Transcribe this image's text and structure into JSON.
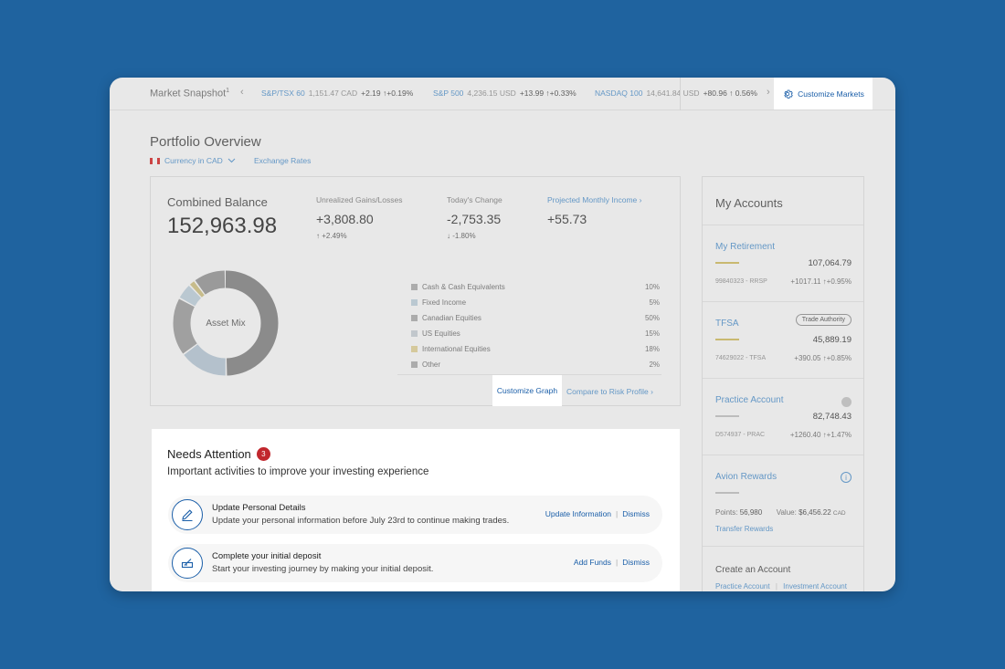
{
  "ticker": {
    "title": "Market Snapshot",
    "title_sup": "1",
    "items": [
      {
        "name": "S&P/TSX 60",
        "price": "1,151.47 CAD",
        "change": "+2.19 ↑+0.19%"
      },
      {
        "name": "S&P 500",
        "price": "4,236.15 USD",
        "change": "+13.99 ↑+0.33%"
      },
      {
        "name": "NASDAQ 100",
        "price": "14,641.84 USD",
        "change": "+80.96 ↑ 0.56%"
      }
    ],
    "customize_label": "Customize Markets"
  },
  "header": {
    "title": "Portfolio Overview",
    "currency": "Currency in CAD",
    "exchange_rates": "Exchange Rates"
  },
  "overview": {
    "combined_label": "Combined Balance",
    "combined_value": "152,963.98",
    "unrealized_label": "Unrealized Gains/Losses",
    "unrealized_value": "+3,808.80",
    "unrealized_pct": "↑ +2.49%",
    "today_label": "Today's Change",
    "today_value": "-2,753.35",
    "today_pct": "↓ -1.80%",
    "income_label": "Projected Monthly Income",
    "income_value": "+55.73",
    "donut_label": "Asset Mix",
    "customize_graph": "Customize Graph",
    "compare_risk": "Compare to Risk Profile"
  },
  "asset_mix": [
    {
      "name": "Cash & Cash Equivalents",
      "pct": "10%",
      "value": 10,
      "color": "#9e9e9e",
      "legend": "#b5b5b5"
    },
    {
      "name": "Fixed Income",
      "pct": "5%",
      "value": 5,
      "color": "#c6d7e3",
      "legend": "#c6d7e3"
    },
    {
      "name": "Canadian Equities",
      "pct": "50%",
      "value": 50,
      "color": "#8b8b8b",
      "legend": "#b5b5b5"
    },
    {
      "name": "US Equities",
      "pct": "15%",
      "value": 15,
      "color": "#bfcfdc",
      "legend": "#cfd6dc"
    },
    {
      "name": "International Equities",
      "pct": "18%",
      "value": 18,
      "color": "#a5a5a5",
      "legend": "#e8d9a0"
    },
    {
      "name": "Other",
      "pct": "2%",
      "value": 2,
      "color": "#d6c98b",
      "legend": "#b5b5b5"
    }
  ],
  "attention": {
    "title": "Needs Attention",
    "count": "3",
    "subtitle": "Important activities to improve your investing experience",
    "items": [
      {
        "title": "Update Personal Details",
        "desc": "Update your personal information before July 23rd to continue making trades.",
        "action": "Update Information",
        "dismiss": "Dismiss",
        "icon": "pencil-icon"
      },
      {
        "title": "Complete your initial deposit",
        "desc": "Start your investing journey by making your initial deposit.",
        "action": "Add Funds",
        "dismiss": "Dismiss",
        "icon": "deposit-icon"
      }
    ]
  },
  "accounts": {
    "title": "My Accounts",
    "list": [
      {
        "name": "My Retirement",
        "balance": "107,064.79",
        "id": "99840323 - RRSP",
        "gain": "+1017.11 ↑+0.95%",
        "color": "#d9c56a"
      },
      {
        "name": "TFSA",
        "balance": "45,889.19",
        "id": "74629022 - TFSA",
        "gain": "+390.05 ↑+0.85%",
        "color": "#d9c56a",
        "tag": "Trade Authority"
      },
      {
        "name": "Practice Account",
        "balance": "82,748.43",
        "id": "D574937 - PRAC",
        "gain": "+1260.40 ↑+1.47%",
        "color": "#c8c8c8"
      }
    ],
    "avion": {
      "name": "Avion Rewards",
      "points_label": "Points:",
      "points": "56,980",
      "value_label": "Value:",
      "value": "$6,456.22",
      "value_cur": "CAD",
      "transfer": "Transfer Rewards"
    },
    "create": {
      "title": "Create an Account",
      "practice": "Practice Account",
      "investment": "Investment Account"
    }
  }
}
